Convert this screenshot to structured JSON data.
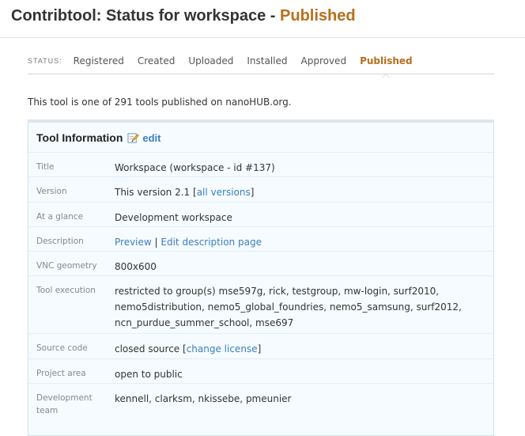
{
  "header": {
    "title_prefix": "Contribtool: Status for workspace - ",
    "title_status": "Published"
  },
  "status_nav": {
    "label": "STATUS:",
    "steps": [
      {
        "label": "Registered",
        "active": false
      },
      {
        "label": "Created",
        "active": false
      },
      {
        "label": "Uploaded",
        "active": false
      },
      {
        "label": "Installed",
        "active": false
      },
      {
        "label": "Approved",
        "active": false
      },
      {
        "label": "Published",
        "active": true
      }
    ]
  },
  "intro": "This tool is one of 291 tools published on nanoHUB.org.",
  "tool_info": {
    "heading": "Tool Information",
    "edit_label": "edit",
    "rows": {
      "title": {
        "label": "Title",
        "value": "Workspace (workspace - id #137)"
      },
      "version": {
        "label": "Version",
        "value_prefix": "This version 2.1 [",
        "link": "all versions",
        "value_suffix": "]"
      },
      "glance": {
        "label": "At a glance",
        "value": "Development workspace"
      },
      "description": {
        "label": "Description",
        "preview_link": "Preview",
        "separator": " | ",
        "edit_link": "Edit description page"
      },
      "vnc": {
        "label": "VNC geometry",
        "value": "800x600"
      },
      "execution": {
        "label": "Tool execution",
        "value": "restricted to group(s) mse597g, rick, testgroup, mw-login, surf2010, nemo5distribution, nemo5_global_foundries, nemo5_samsung, surf2012, ncn_purdue_summer_school, mse697"
      },
      "source": {
        "label": "Source code",
        "value_prefix": "closed source [",
        "link": "change license",
        "value_suffix": "]"
      },
      "project": {
        "label": "Project area",
        "value": "open to public"
      },
      "team": {
        "label": "Development team",
        "value": "kennell, clarksm, nkissebe, pmeunier"
      }
    }
  },
  "colors": {
    "accent": "#b86f1c",
    "link": "#3b7fbf",
    "panel_bg": "#f5fbff"
  }
}
